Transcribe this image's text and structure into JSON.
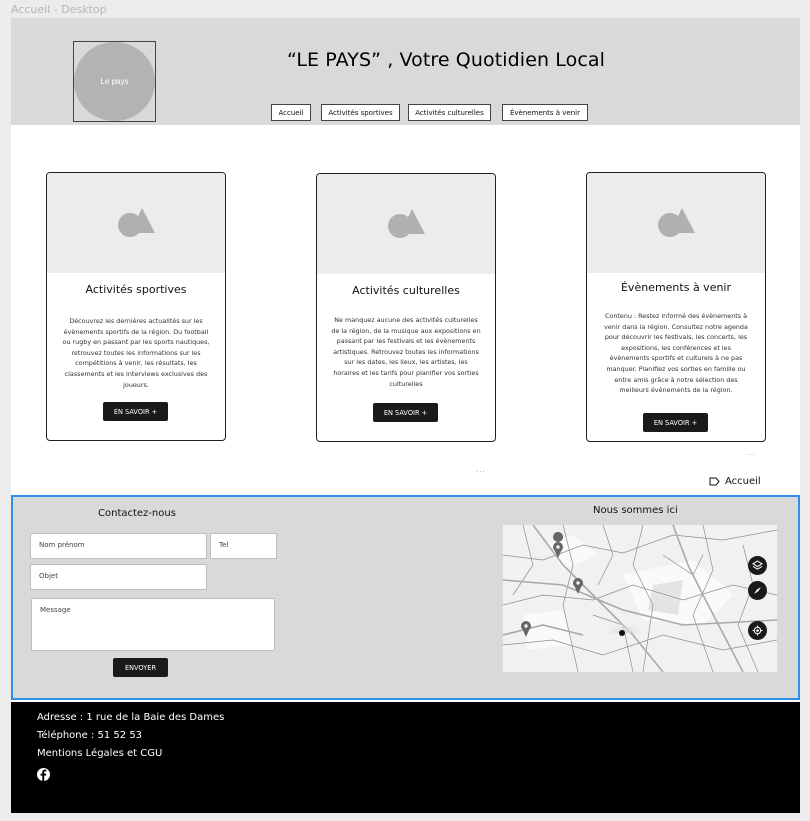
{
  "frame_label": "Accueil - Desktop",
  "header": {
    "logo_text": "Le pays",
    "title": "“LE PAYS” , Votre Quotidien Local",
    "nav": [
      "Accueil",
      "Activités sportives",
      "Activités culturelles",
      "Évènements à venir"
    ]
  },
  "cards": [
    {
      "title": "Activités sportives",
      "text": "Découvrez les dernières actualités sur les évènements sportifs de la région. Du football ou rugby en passant par les sports nautiques, retrouvez toutes les informations sur les compétitions à venir, les résultats, les classements et les interviews exclusives des joueurs.",
      "button": "EN SAVOIR +"
    },
    {
      "title": "Activités culturelles",
      "text": "Ne manquez aucune des activités culturelles de la région, de la musique aux expositions en passant par les festivals et les évènements artistiques. Retrouvez toutes les informations sur les dates, les lieux, les artistes, les horaires et les tarifs pour planifier vos sorties culturelles",
      "button": "EN SAVOIR +"
    },
    {
      "title": "Évènements à venir",
      "text": "Contenu : Restez informé des évènements à venir dans la région. Consultez notre agenda pour découvrir les festivals, les concerts, les expositions, les conférences et les évènements sportifs et culturels à ne pas manquer. Planifiez vos sorties en famille ou entre amis grâce à notre sélection des meilleurs évènements de la région.",
      "button": "EN SAVOIR +"
    }
  ],
  "dots": "...",
  "accueil_link": "Accueil",
  "contact": {
    "title": "Contactez-nous",
    "name_placeholder": "Nom prénom",
    "tel_placeholder": "Tel",
    "subject_placeholder": "Objet",
    "message_placeholder": "Message",
    "send": "ENVOYER"
  },
  "map": {
    "title": "Nous sommes ici",
    "controls": [
      "layers-icon",
      "compass-icon",
      "locate-icon"
    ]
  },
  "footer": {
    "address": "Adresse : 1 rue de la Baie des Dames",
    "phone": "Téléphone  : 51 52 53",
    "legal": "Mentions Légales et CGU",
    "social": "facebook-icon"
  },
  "colors": {
    "header_bg": "#d9d9d9",
    "dark": "#1a1a1a",
    "selection": "#2f8fe8",
    "footer_bg": "#000000"
  }
}
